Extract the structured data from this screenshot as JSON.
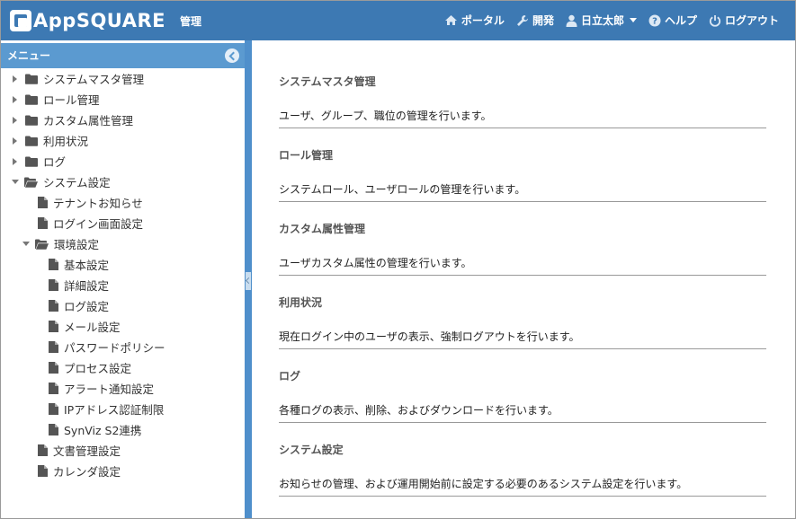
{
  "header": {
    "logo_text": "AppSQUARE",
    "subtitle": "管理",
    "nav": {
      "portal": "ポータル",
      "dev": "開発",
      "user": "日立太郎",
      "help": "ヘルプ",
      "logout": "ログアウト"
    }
  },
  "sidebar": {
    "title": "メニュー",
    "items": [
      {
        "label": "システムマスタ管理"
      },
      {
        "label": "ロール管理"
      },
      {
        "label": "カスタム属性管理"
      },
      {
        "label": "利用状況"
      },
      {
        "label": "ログ"
      },
      {
        "label": "システム設定"
      },
      {
        "label": "テナントお知らせ"
      },
      {
        "label": "ログイン画面設定"
      },
      {
        "label": "環境設定"
      },
      {
        "label": "基本設定"
      },
      {
        "label": "詳細設定"
      },
      {
        "label": "ログ設定"
      },
      {
        "label": "メール設定"
      },
      {
        "label": "パスワードポリシー"
      },
      {
        "label": "プロセス設定"
      },
      {
        "label": "アラート通知設定"
      },
      {
        "label": "IPアドレス認証制限"
      },
      {
        "label": "SynViz S2連携"
      },
      {
        "label": "文書管理設定"
      },
      {
        "label": "カレンダ設定"
      }
    ]
  },
  "main": {
    "sections": [
      {
        "title": "システムマスタ管理",
        "desc": "ユーザ、グループ、職位の管理を行います。"
      },
      {
        "title": "ロール管理",
        "desc": "システムロール、ユーザロールの管理を行います。"
      },
      {
        "title": "カスタム属性管理",
        "desc": "ユーザカスタム属性の管理を行います。"
      },
      {
        "title": "利用状況",
        "desc": "現在ログイン中のユーザの表示、強制ログアウトを行います。"
      },
      {
        "title": "ログ",
        "desc": "各種ログの表示、削除、およびダウンロードを行います。"
      },
      {
        "title": "システム設定",
        "desc": "お知らせの管理、および運用開始前に設定する必要のあるシステム設定を行います。"
      }
    ]
  },
  "colors": {
    "header_bg": "#3d79b3",
    "menu_title_bg": "#5b9ad0",
    "splitter": "#4f8fcb"
  }
}
